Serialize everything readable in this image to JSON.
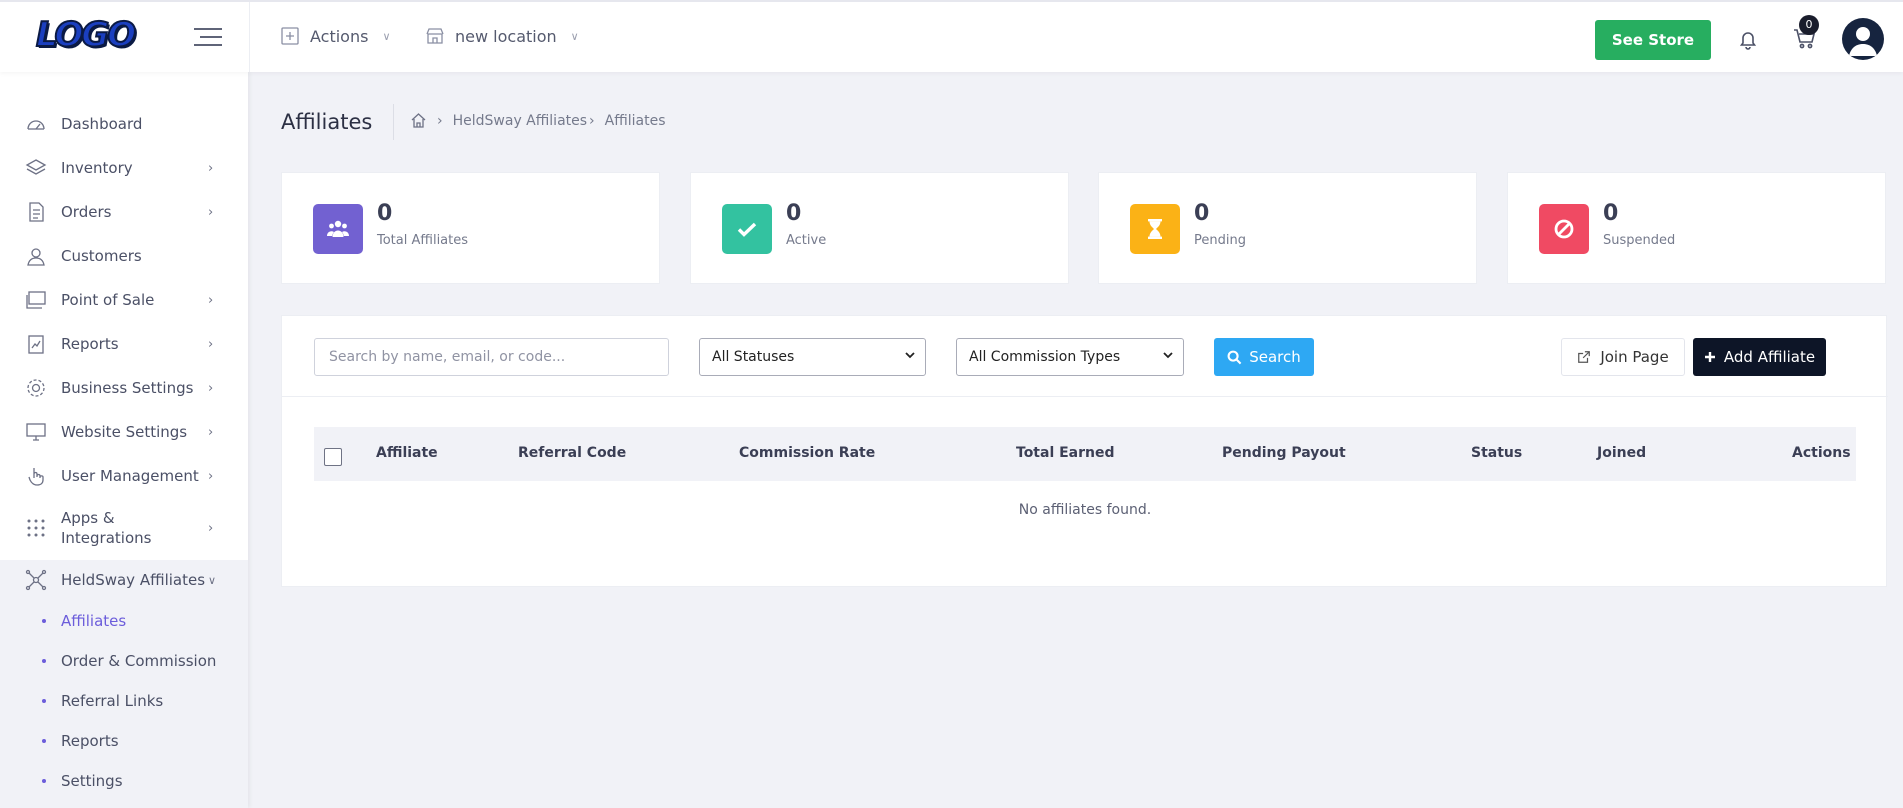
{
  "topbar": {
    "logo_text": "LOGO",
    "actions_label": "Actions",
    "location_label": "new location",
    "see_store_label": "See Store",
    "cart_count": "0"
  },
  "sidebar": {
    "items": [
      {
        "label": "Dashboard"
      },
      {
        "label": "Inventory"
      },
      {
        "label": "Orders"
      },
      {
        "label": "Customers"
      },
      {
        "label": "Point of Sale"
      },
      {
        "label": "Reports"
      },
      {
        "label": "Business Settings"
      },
      {
        "label": "Website Settings"
      },
      {
        "label": "User Management"
      },
      {
        "label": "Apps & Integrations"
      },
      {
        "label": "HeldSway Affiliates"
      }
    ],
    "sub_items": [
      {
        "label": "Affiliates"
      },
      {
        "label": "Order & Commission"
      },
      {
        "label": "Referral Links"
      },
      {
        "label": "Reports"
      },
      {
        "label": "Settings"
      }
    ]
  },
  "page": {
    "title": "Affiliates",
    "breadcrumb": [
      "HeldSway Affiliates",
      "Affiliates"
    ]
  },
  "stats": [
    {
      "value": "0",
      "label": "Total Affiliates",
      "color": "#7261d1"
    },
    {
      "value": "0",
      "label": "Active",
      "color": "#33c2a0"
    },
    {
      "value": "0",
      "label": "Pending",
      "color": "#fbb216"
    },
    {
      "value": "0",
      "label": "Suspended",
      "color": "#f04a63"
    }
  ],
  "filters": {
    "search_placeholder": "Search by name, email, or code...",
    "status_selected": "All Statuses",
    "commission_selected": "All Commission Types",
    "search_label": "Search",
    "join_page_label": "Join Page",
    "add_affiliate_label": "Add Affiliate"
  },
  "table": {
    "columns": [
      "Affiliate",
      "Referral Code",
      "Commission Rate",
      "Total Earned",
      "Pending Payout",
      "Status",
      "Joined",
      "Actions"
    ],
    "empty_message": "No affiliates found."
  }
}
